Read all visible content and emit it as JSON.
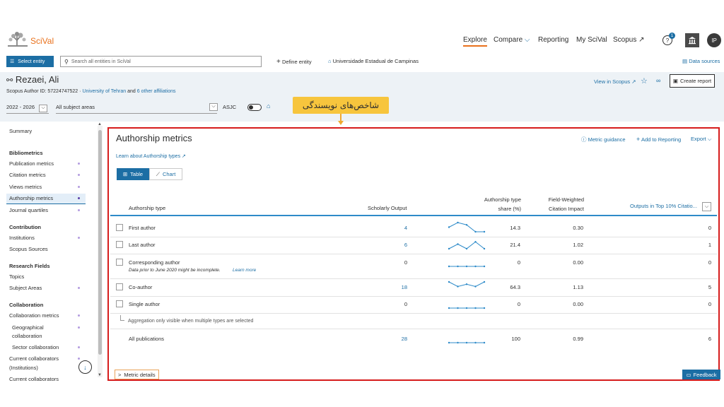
{
  "nav": {
    "logo": "SciVal",
    "explore": "Explore",
    "compare": "Compare",
    "reporting": "Reporting",
    "my_scival": "My SciVal",
    "scopus": "Scopus ↗",
    "notification_count": "1",
    "avatar_initials": "IP"
  },
  "toolbar": {
    "select_entity": "Select entity",
    "search_placeholder": "Search all entities in SciVal",
    "define_entity": "Define entity",
    "institution": "Universidade Estadual de Campinas",
    "data_sources": "Data sources"
  },
  "author": {
    "name": "Rezaei, Ali",
    "id_line": "Scopus Author ID: 57224747522",
    "affiliation": "University of Tehran",
    "and": "and",
    "other_affiliations": "6 other affiliations",
    "year_range": "2022 - 2026",
    "subject_areas": "All subject areas",
    "asjc": "ASJC",
    "view_in_scopus": "View in Scopus ↗",
    "create_report": "Create report"
  },
  "callout": "شاخص‌های نویسندگی",
  "sidebar": {
    "items": [
      {
        "label": "Summary",
        "head": false,
        "dot": false
      },
      {
        "label": "Bibliometrics",
        "head": true,
        "dot": false
      },
      {
        "label": "Publication metrics",
        "head": false,
        "dot": true
      },
      {
        "label": "Citation metrics",
        "head": false,
        "dot": true
      },
      {
        "label": "Views metrics",
        "head": false,
        "dot": true
      },
      {
        "label": "Authorship metrics",
        "head": false,
        "dot": true
      },
      {
        "label": "Journal quartiles",
        "head": false,
        "dot": true
      },
      {
        "label": "Contribution",
        "head": true,
        "dot": false
      },
      {
        "label": "Institutions",
        "head": false,
        "dot": true
      },
      {
        "label": "Scopus Sources",
        "head": false,
        "dot": false
      },
      {
        "label": "Research Fields",
        "head": true,
        "dot": false
      },
      {
        "label": "Topics",
        "head": false,
        "dot": false
      },
      {
        "label": "Subject Areas",
        "head": false,
        "dot": true
      },
      {
        "label": "Collaboration",
        "head": true,
        "dot": false
      },
      {
        "label": "Collaboration metrics",
        "head": false,
        "dot": true
      },
      {
        "label": "Geographical",
        "head": false,
        "dot": true
      },
      {
        "label": "collaboration",
        "head": false,
        "dot": false
      },
      {
        "label": "Sector collaboration",
        "head": false,
        "dot": true
      },
      {
        "label": "Current collaborators",
        "head": false,
        "dot": true
      },
      {
        "label": "(Institutions)",
        "head": false,
        "dot": false
      },
      {
        "label": "Current collaborators",
        "head": false,
        "dot": false
      }
    ]
  },
  "panel": {
    "title": "Authorship metrics",
    "metric_guidance": "Metric guidance",
    "add_to_reporting": "Add to Reporting",
    "export": "Export",
    "learn_link": "Learn about Authorship types ↗",
    "tab_table": "Table",
    "tab_chart": "Chart",
    "columns": {
      "type": "Authorship type",
      "output": "Scholarly Output",
      "share_1": "Authorship type",
      "share_2": "share (%)",
      "fwci_1": "Field-Weighted",
      "fwci_2": "Citation Impact",
      "top10": "Outputs in Top 10% Citatio..."
    },
    "rows": [
      {
        "type": "First author",
        "output": "4",
        "share": "14.3",
        "fwci": "0.30",
        "top10": "0",
        "spark": [
          2,
          4,
          3,
          0,
          0
        ]
      },
      {
        "type": "Last author",
        "output": "6",
        "share": "21.4",
        "fwci": "1.02",
        "top10": "1",
        "spark": [
          0,
          2,
          0,
          3,
          0
        ]
      },
      {
        "type": "Corresponding author",
        "output": "0",
        "share": "0",
        "fwci": "0.00",
        "top10": "0",
        "spark": [
          0,
          0,
          0,
          0,
          0
        ]
      },
      {
        "type": "Co-author",
        "output": "18",
        "share": "64.3",
        "fwci": "1.13",
        "top10": "5",
        "spark": [
          4,
          2,
          3,
          2,
          4
        ]
      },
      {
        "type": "Single author",
        "output": "0",
        "share": "0",
        "fwci": "0.00",
        "top10": "0",
        "spark": [
          0,
          0,
          0,
          0,
          0
        ]
      }
    ],
    "note_corresponding": "Data prior to June 2020 might be incomplete.",
    "note_learn_more": "Learn more",
    "aggregation_note": "Aggregation only visible when multiple types are selected",
    "all_pubs": {
      "type": "All publications",
      "output": "28",
      "share": "100",
      "fwci": "0.99",
      "top10": "6",
      "spark": [
        0,
        0,
        0,
        0,
        0
      ]
    },
    "metric_details": "Metric details",
    "feedback": "Feedback"
  }
}
